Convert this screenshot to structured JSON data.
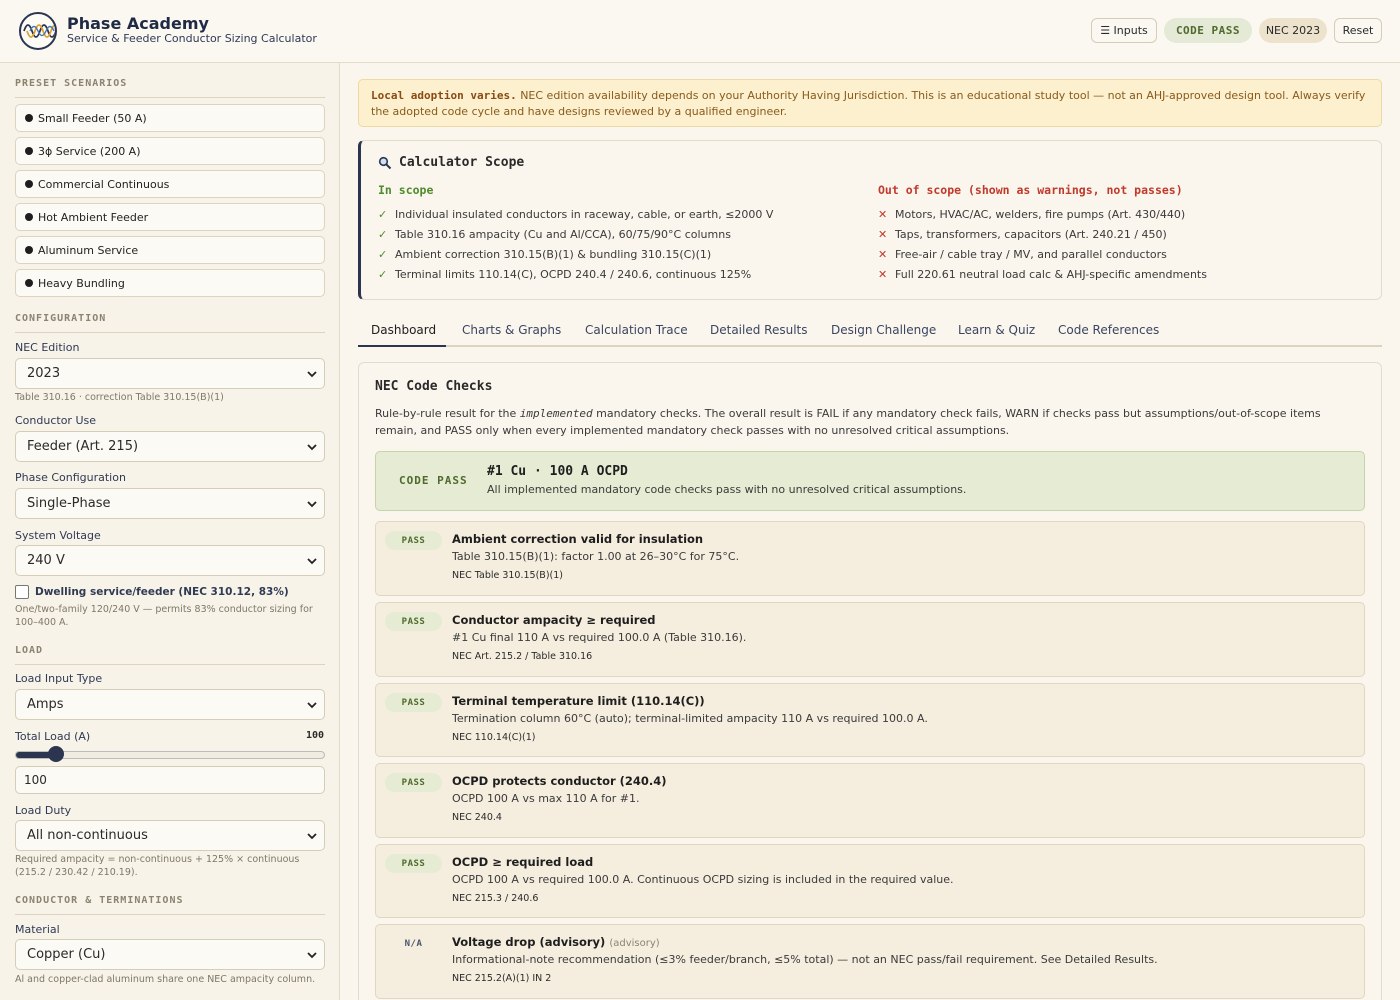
{
  "header": {
    "title": "Phase Academy",
    "subtitle": "Service & Feeder Conductor Sizing Calculator",
    "inputs_label": "☰ Inputs",
    "status_pill": "CODE PASS",
    "nec_pill": "NEC 2023",
    "reset_label": "Reset"
  },
  "sidebar": {
    "presets_title": "PRESET SCENARIOS",
    "presets": [
      "Small Feeder (50 A)",
      "3ϕ Service (200 A)",
      "Commercial Continuous",
      "Hot Ambient Feeder",
      "Aluminum Service",
      "Heavy Bundling"
    ],
    "config_title": "CONFIGURATION",
    "nec_edition_label": "NEC Edition",
    "nec_edition_value": "2023",
    "nec_edition_hint": "Table 310.16 · correction Table 310.15(B)(1)",
    "conductor_use_label": "Conductor Use",
    "conductor_use_value": "Feeder (Art. 215)",
    "phase_label": "Phase Configuration",
    "phase_value": "Single-Phase",
    "voltage_label": "System Voltage",
    "voltage_value": "240 V",
    "dwelling_label": "Dwelling service/feeder (NEC 310.12, 83%)",
    "dwelling_hint": "One/two-family 120/240 V — permits 83% conductor sizing for 100–400 A.",
    "load_title": "LOAD",
    "load_input_label": "Load Input Type",
    "load_input_value": "Amps",
    "total_load_label": "Total Load (A)",
    "total_load_display": "100",
    "total_load_input": "100",
    "total_load_slider_fraction": 0.13,
    "load_duty_label": "Load Duty",
    "load_duty_value": "All non-continuous",
    "load_duty_hint": "Required ampacity = non-continuous + 125% × continuous (215.2 / 230.42 / 210.19).",
    "conductor_title": "CONDUCTOR & TERMINATIONS",
    "material_label": "Material",
    "material_value": "Copper (Cu)",
    "material_hint": "Al and copper-clad aluminum share one NEC ampacity column."
  },
  "notice": {
    "bold": "Local adoption varies.",
    "text": " NEC edition availability depends on your Authority Having Jurisdiction. This is an educational study tool — not an AHJ-approved design tool. Always verify the adopted code cycle and have designs reviewed by a qualified engineer."
  },
  "scope": {
    "title": "Calculator Scope",
    "in_title": "In scope",
    "out_title": "Out of scope (shown as warnings, not passes)",
    "in_items": [
      "Individual insulated conductors in raceway, cable, or earth, ≤2000 V",
      "Table 310.16 ampacity (Cu and Al/CCA), 60/75/90°C columns",
      "Ambient correction 310.15(B)(1) & bundling 310.15(C)(1)",
      "Terminal limits 110.14(C), OCPD 240.4 / 240.6, continuous 125%"
    ],
    "out_items": [
      "Motors, HVAC/AC, welders, fire pumps (Art. 430/440)",
      "Taps, transformers, capacitors (Art. 240.21 / 450)",
      "Free-air / cable tray / MV, and parallel conductors",
      "Full 220.61 neutral load calc & AHJ-specific amendments"
    ],
    "check_mark": "✓",
    "x_mark": "✕"
  },
  "tabs": [
    "Dashboard",
    "Charts & Graphs",
    "Calculation Trace",
    "Detailed Results",
    "Design Challenge",
    "Learn & Quiz",
    "Code References"
  ],
  "panel": {
    "title": "NEC Code Checks",
    "desc_pre": "Rule-by-rule result for the ",
    "desc_em": "implemented",
    "desc_post": " mandatory checks. The overall result is FAIL if any mandatory check fails, WARN if checks pass but assumptions/out-of-scope items remain, and PASS only when every implemented mandatory check passes with no unresolved critical assumptions.",
    "summary_badge": "CODE PASS",
    "summary_title": "#1 Cu · 100 A OCPD",
    "summary_sub": "All implemented mandatory code checks pass with no unresolved critical assumptions.",
    "checks": [
      {
        "status": "PASS",
        "title": "Ambient correction valid for insulation",
        "advisory": "",
        "desc": "Table 310.15(B)(1): factor 1.00 at 26–30°C for 75°C.",
        "ref": "NEC Table 310.15(B)(1)"
      },
      {
        "status": "PASS",
        "title": "Conductor ampacity ≥ required",
        "advisory": "",
        "desc": "#1 Cu final 110 A vs required 100.0 A (Table 310.16).",
        "ref": "NEC Art. 215.2 / Table 310.16"
      },
      {
        "status": "PASS",
        "title": "Terminal temperature limit (110.14(C))",
        "advisory": "",
        "desc": "Termination column 60°C (auto); terminal-limited ampacity 110 A vs required 100.0 A.",
        "ref": "NEC 110.14(C)(1)"
      },
      {
        "status": "PASS",
        "title": "OCPD protects conductor (240.4)",
        "advisory": "",
        "desc": "OCPD 100 A vs max 110 A for #1.",
        "ref": "NEC 240.4"
      },
      {
        "status": "PASS",
        "title": "OCPD ≥ required load",
        "advisory": "",
        "desc": "OCPD 100 A vs required 100.0 A. Continuous OCPD sizing is included in the required value.",
        "ref": "NEC 215.3 / 240.6"
      },
      {
        "status": "N/A",
        "title": "Voltage drop (advisory)",
        "advisory": "(advisory)",
        "desc": "Informational-note recommendation (≤3% feeder/branch, ≤5% total) — not an NEC pass/fail requirement. See Detailed Results.",
        "ref": "NEC 215.2(A)(1) IN 2"
      }
    ]
  },
  "colors": {
    "accent": "#2b3550",
    "pass_bg": "#e6ecd4",
    "pass_text": "#4f6a2c",
    "warn_bg": "#fcf0cf",
    "out_scope": "#c0392b",
    "in_scope": "#4f8a2c"
  }
}
